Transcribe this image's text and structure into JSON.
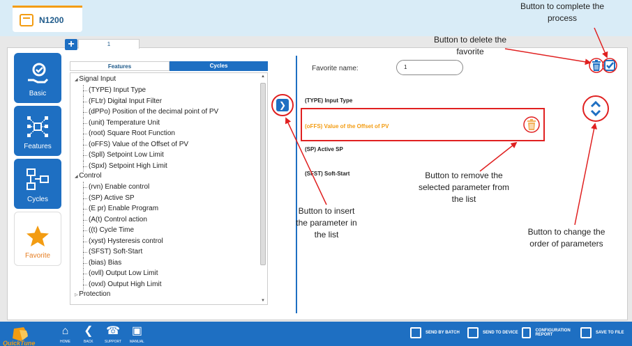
{
  "device": {
    "name": "N1200"
  },
  "favorite_tab": {
    "label": "1"
  },
  "sidebar": {
    "items": [
      {
        "label": "Basic"
      },
      {
        "label": "Features"
      },
      {
        "label": "Cycles"
      },
      {
        "label": "Favorite"
      }
    ]
  },
  "features_panel": {
    "tabs": [
      {
        "label": "Features"
      },
      {
        "label": "Cycles"
      }
    ],
    "groups": [
      {
        "label": "Signal Input",
        "items": [
          "(TYPE) Input Type",
          "(FLtr) Digital Input Filter",
          "(dPPo) Position of the decimal point of PV",
          "(unit) Temperature Unit",
          "(root) Square Root Function",
          "(oFFS) Value of the Offset of PV",
          "(Spll) Setpoint Low Limit",
          "(Spxl) Setpoint High Limit"
        ]
      },
      {
        "label": "Control",
        "items": [
          "(rvn) Enable control",
          "(SP) Active SP",
          "(E pr) Enable Program",
          "(A(t) Control action",
          "((t) Cycle Time",
          "(xyst) Hysteresis control",
          "(SFST) Soft-Start",
          "(bias) Bias",
          "(ovll) Output Low Limit",
          "(ovxl) Output High Limit"
        ]
      },
      {
        "label": "Protection",
        "items": []
      }
    ]
  },
  "favorite": {
    "name_label": "Favorite name:",
    "name_value": "1",
    "params": [
      "(TYPE) Input Type",
      "(oFFS) Value of the Offset of PV",
      "(SP) Active SP",
      "(SFST) Soft-Start"
    ],
    "selected_index": 1
  },
  "annotations": {
    "complete": "Button to complete the process",
    "delete_fav": "Button to delete the favorite",
    "insert": "Button to insert the parameter in the list",
    "remove": "Button to remove the selected parameter from the list",
    "order": "Button to change the order of parameters"
  },
  "bottom_bar": {
    "logo_text": "QuickTune",
    "nav": [
      "HOME",
      "BACK",
      "SUPPORT",
      "MANUAL"
    ],
    "actions": [
      "SEND BY BATCH",
      "SEND TO DEVICE",
      "CONFIGURATION REPORT",
      "SAVE TO FILE"
    ]
  },
  "colors": {
    "accent": "#1e6fc2",
    "orange": "#f39c12",
    "annotation": "#e02020"
  }
}
